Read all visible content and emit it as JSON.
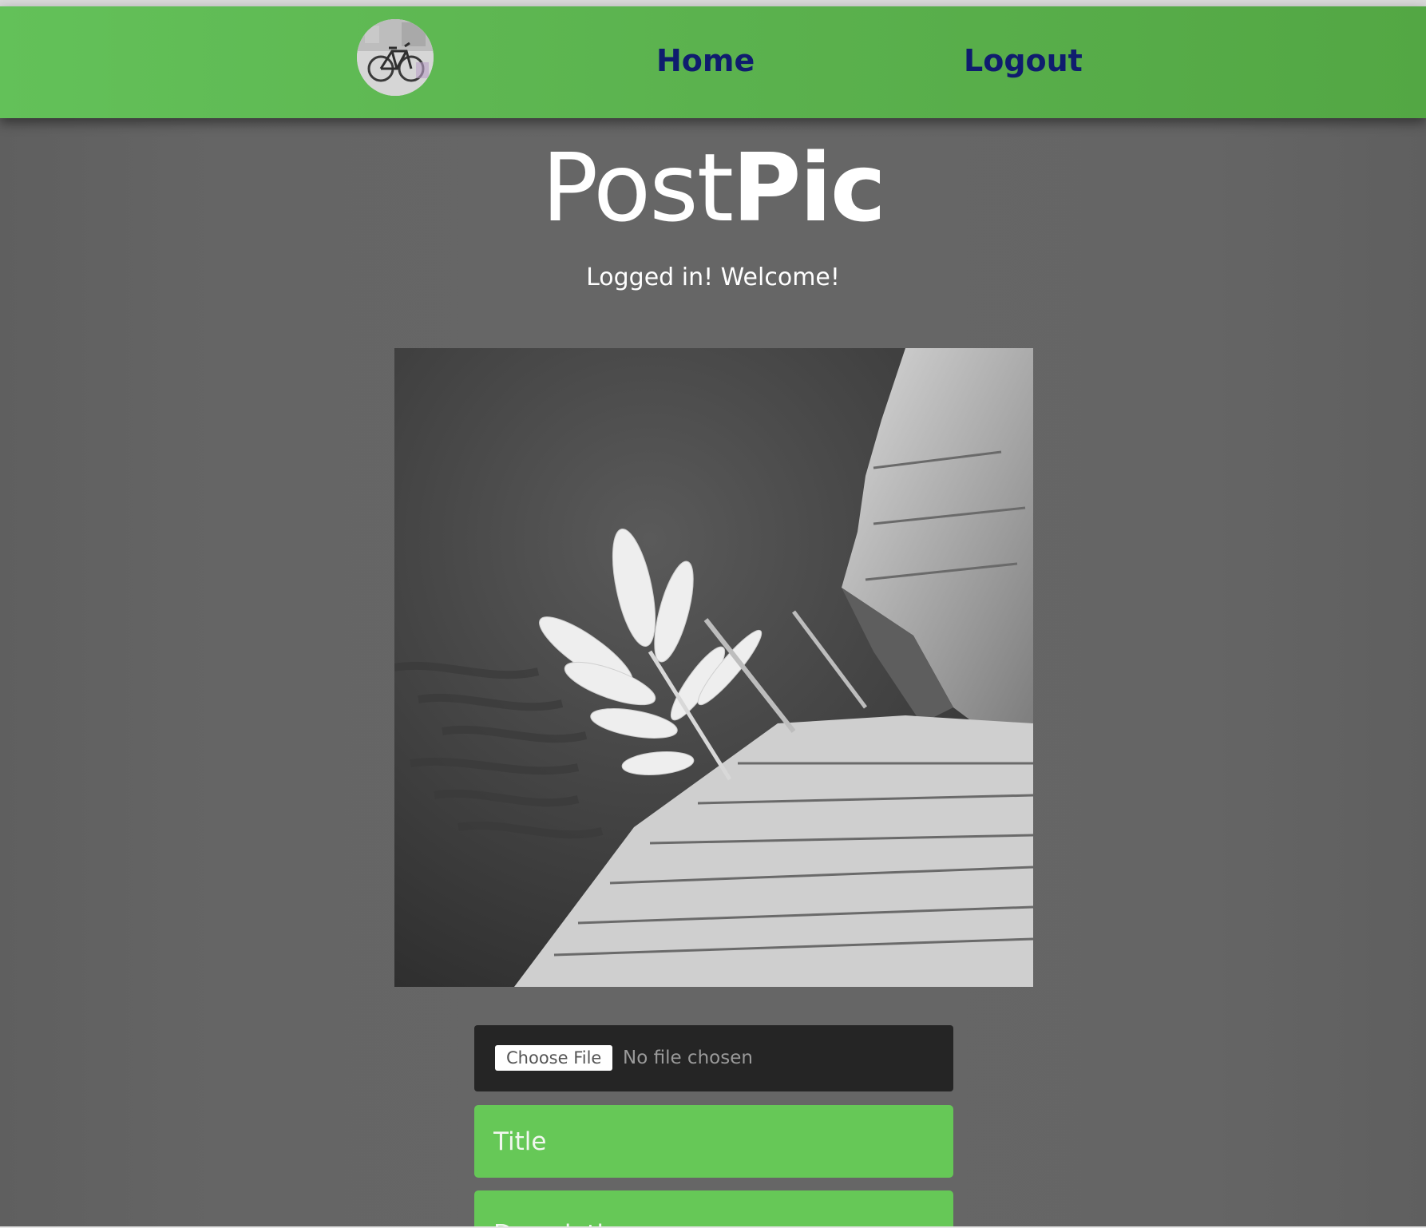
{
  "navbar": {
    "avatar_icon": "bicycle-avatar-icon",
    "home_label": "Home",
    "logout_label": "Logout",
    "background": "#5bb24e",
    "link_color": "#0f1d6e"
  },
  "brand": {
    "light_part": "Post",
    "bold_part": "Pic"
  },
  "welcome_message": "Logged in! Welcome!",
  "upload": {
    "choose_button_label": "Choose File",
    "file_status": "No file chosen",
    "title_placeholder": "Title",
    "description_placeholder": "Description",
    "field_color": "#66c857"
  },
  "page": {
    "background": "#666666"
  }
}
